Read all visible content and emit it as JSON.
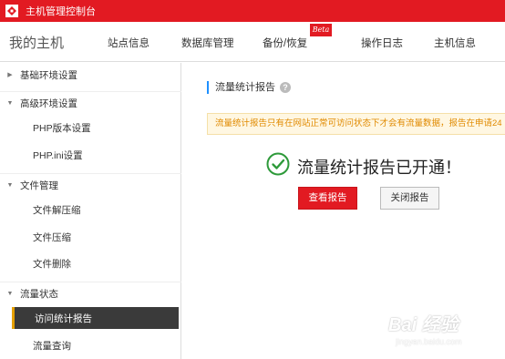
{
  "topbar": {
    "title": "主机管理控制台"
  },
  "nav": {
    "brand": "我的主机",
    "items": [
      {
        "label": "站点信息"
      },
      {
        "label": "数据库管理"
      },
      {
        "label": "备份/恢复"
      },
      {
        "label": "操作日志"
      },
      {
        "label": "主机信息"
      }
    ],
    "beta_badge": "Beta"
  },
  "sidebar": {
    "groups": [
      {
        "label": "基础环境设置",
        "expanded": false
      },
      {
        "label": "高级环境设置",
        "expanded": true,
        "items": [
          "PHP版本设置",
          "PHP.ini设置"
        ]
      },
      {
        "label": "文件管理",
        "expanded": true,
        "items": [
          "文件解压缩",
          "文件压缩",
          "文件删除"
        ]
      },
      {
        "label": "流量状态",
        "expanded": true,
        "items": [
          "访问统计报告",
          "流量查询"
        ]
      }
    ],
    "active_item": "访问统计报告"
  },
  "main": {
    "section_title": "流量统计报告",
    "help_icon": "?",
    "notice": "流量统计报告只有在网站正常可访问状态下才会有流量数据，报告在申请24",
    "success_message": "流量统计报告已开通！",
    "view_button": "查看报告",
    "close_button": "关闭报告"
  },
  "watermark": {
    "main": "Bai 经验",
    "sub": "jingyan.baidu.com"
  },
  "colors": {
    "brand_red": "#e21a22",
    "success_green": "#2e9a3a",
    "notice_text": "#e08a00",
    "active_bg": "#3a3a3a"
  }
}
